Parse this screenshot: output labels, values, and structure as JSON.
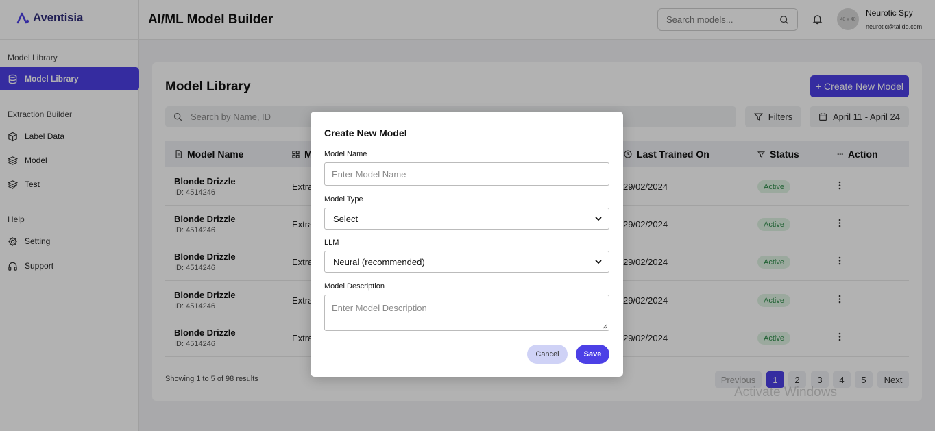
{
  "brand": {
    "name": "Aventisia"
  },
  "sidebar": {
    "sections": [
      {
        "title": "Model Library"
      },
      {
        "title": "Extraction Builder"
      },
      {
        "title": "Help"
      }
    ],
    "items": [
      {
        "label": "Model Library",
        "icon": "database-icon",
        "active": true
      },
      {
        "label": "Label Data",
        "icon": "cube-icon"
      },
      {
        "label": "Model",
        "icon": "layers-icon"
      },
      {
        "label": "Test",
        "icon": "layers-icon"
      },
      {
        "label": "Setting",
        "icon": "gear-icon"
      },
      {
        "label": "Support",
        "icon": "headphones-icon"
      }
    ]
  },
  "header": {
    "title": "AI/ML Model Builder",
    "search_placeholder": "Search models...",
    "avatar_text": "40 x 40",
    "user_name": "Neurotic Spy",
    "user_email": "neurotic@taildo.com"
  },
  "library": {
    "title": "Model Library",
    "create_label": "+ Create New Model",
    "search_placeholder": "Search by Name, ID",
    "filters_label": "Filters",
    "date_range": "April 11 - April 24",
    "columns": [
      "Model Name",
      "M",
      "Last Trained On",
      "Status",
      "Action"
    ],
    "rows": [
      {
        "name": "Blonde Drizzle",
        "id": "ID: 4514246",
        "type": "Extra",
        "date": "29/02/2024",
        "status": "Active"
      },
      {
        "name": "Blonde Drizzle",
        "id": "ID: 4514246",
        "type": "Extra",
        "date": "29/02/2024",
        "status": "Active"
      },
      {
        "name": "Blonde Drizzle",
        "id": "ID: 4514246",
        "type": "Extra",
        "date": "29/02/2024",
        "status": "Active"
      },
      {
        "name": "Blonde Drizzle",
        "id": "ID: 4514246",
        "type": "Extra",
        "date": "29/02/2024",
        "status": "Active"
      },
      {
        "name": "Blonde Drizzle",
        "id": "ID: 4514246",
        "type": "Extra",
        "date": "29/02/2024",
        "status": "Active"
      }
    ],
    "results_text": "Showing 1 to 5 of 98 results",
    "pagination": {
      "previous": "Previous",
      "pages": [
        "1",
        "2",
        "3",
        "4",
        "5"
      ],
      "current": "1",
      "next": "Next"
    }
  },
  "watermark": "Activate Windows",
  "modal": {
    "title": "Create New Model",
    "model_name_label": "Model Name",
    "model_name_placeholder": "Enter Model Name",
    "model_type_label": "Model Type",
    "model_type_value": "Select",
    "llm_label": "LLM",
    "llm_value": "Neural (recommended)",
    "description_label": "Model Description",
    "description_placeholder": "Enter Model Description",
    "cancel_label": "Cancel",
    "save_label": "Save"
  },
  "colors": {
    "accent": "#4c40e6",
    "status_bg": "#dff3e3",
    "status_text": "#2e8b4a",
    "overlay": "rgba(0,0,0,0.30)"
  }
}
